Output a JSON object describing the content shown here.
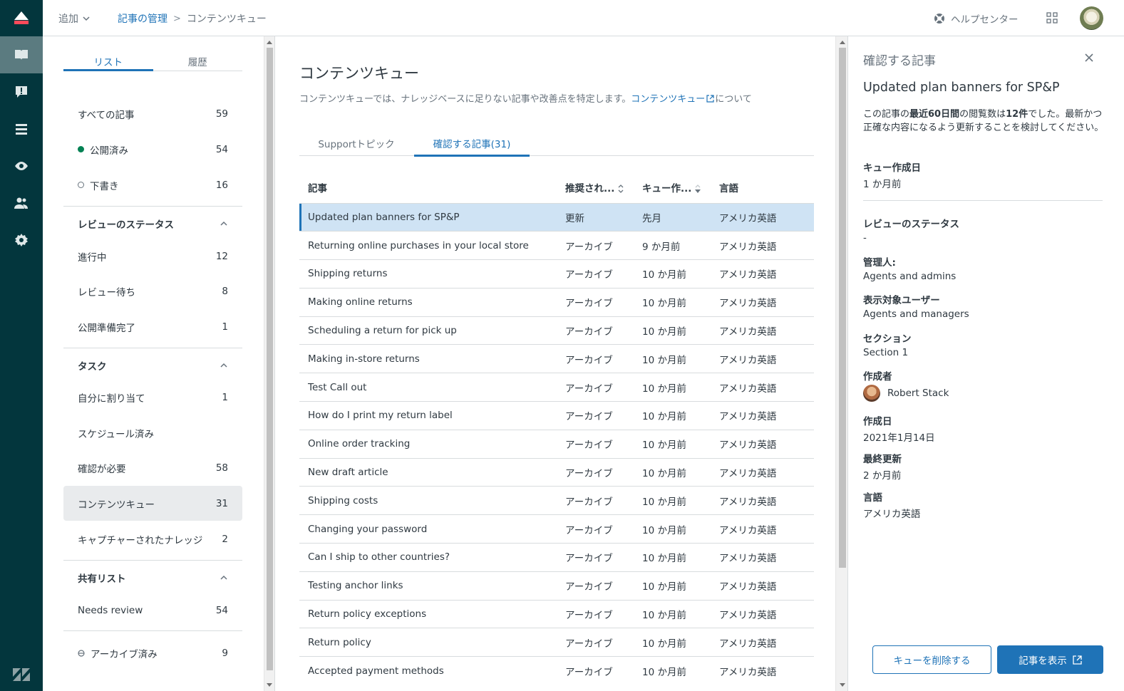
{
  "topbar": {
    "add_label": "追加",
    "breadcrumb": {
      "parent": "記事の管理",
      "separator": ">",
      "current": "コンテンツキュー"
    },
    "help_label": "ヘルプセンター"
  },
  "left": {
    "tabs": [
      "リスト",
      "履歴"
    ],
    "rows": [
      {
        "label": "すべての記事",
        "count": "59"
      },
      {
        "label": "公開済み",
        "count": "54"
      },
      {
        "label": "下書き",
        "count": "16"
      }
    ],
    "review_status": {
      "title": "レビューのステータス",
      "items": [
        {
          "label": "進行中",
          "count": "12"
        },
        {
          "label": "レビュー待ち",
          "count": "8"
        },
        {
          "label": "公開準備完了",
          "count": "1"
        }
      ]
    },
    "tasks": {
      "title": "タスク",
      "items": [
        {
          "label": "自分に割り当て",
          "count": "1"
        },
        {
          "label": "スケジュール済み",
          "count": ""
        },
        {
          "label": "確認が必要",
          "count": "58"
        },
        {
          "label": "コンテンツキュー",
          "count": "31"
        },
        {
          "label": "キャプチャーされたナレッジ",
          "count": "2"
        }
      ]
    },
    "shared": {
      "title": "共有リスト",
      "items": [
        {
          "label": "Needs review",
          "count": "54"
        }
      ]
    },
    "archived": {
      "label": "アーカイブ済み",
      "count": "9"
    }
  },
  "main": {
    "title": "コンテンツキュー",
    "desc_prefix": "コンテンツキューでは、ナレッジベースに足りない記事や改善点を特定します。",
    "desc_link": "コンテンツキュー",
    "desc_suffix": "について",
    "tabs": [
      "Supportトピック",
      "確認する記事(31)"
    ],
    "columns": [
      "記事",
      "推奨され...",
      "キュー作...",
      "言語"
    ],
    "rows": [
      [
        "Updated plan banners for SP&P",
        "更新",
        "先月",
        "アメリカ英語"
      ],
      [
        "Returning online purchases in your local store",
        "アーカイブ",
        "9 か月前",
        "アメリカ英語"
      ],
      [
        "Shipping returns",
        "アーカイブ",
        "10 か月前",
        "アメリカ英語"
      ],
      [
        "Making online returns",
        "アーカイブ",
        "10 か月前",
        "アメリカ英語"
      ],
      [
        "Scheduling a return for pick up",
        "アーカイブ",
        "10 か月前",
        "アメリカ英語"
      ],
      [
        "Making in-store returns",
        "アーカイブ",
        "10 か月前",
        "アメリカ英語"
      ],
      [
        "Test Call out",
        "アーカイブ",
        "10 か月前",
        "アメリカ英語"
      ],
      [
        "How do I print my return label",
        "アーカイブ",
        "10 か月前",
        "アメリカ英語"
      ],
      [
        "Online order tracking",
        "アーカイブ",
        "10 か月前",
        "アメリカ英語"
      ],
      [
        "New draft article",
        "アーカイブ",
        "10 か月前",
        "アメリカ英語"
      ],
      [
        "Shipping costs",
        "アーカイブ",
        "10 か月前",
        "アメリカ英語"
      ],
      [
        "Changing your password",
        "アーカイブ",
        "10 か月前",
        "アメリカ英語"
      ],
      [
        "Can I ship to other countries?",
        "アーカイブ",
        "10 か月前",
        "アメリカ英語"
      ],
      [
        "Testing anchor links",
        "アーカイブ",
        "10 か月前",
        "アメリカ英語"
      ],
      [
        "Return policy exceptions",
        "アーカイブ",
        "10 か月前",
        "アメリカ英語"
      ],
      [
        "Return policy",
        "アーカイブ",
        "10 か月前",
        "アメリカ英語"
      ],
      [
        "Accepted payment methods",
        "アーカイブ",
        "10 か月前",
        "アメリカ英語"
      ]
    ]
  },
  "right": {
    "title": "確認する記事",
    "article_title": "Updated plan banners for SP&P",
    "note_parts": [
      "この記事の",
      "最近60日間",
      "の閲覧数は",
      "12件",
      "でした。最新かつ正確な内容になるよう更新することを検討してください。"
    ],
    "fields": [
      {
        "k": "キュー作成日",
        "v": "1 か月前"
      },
      {
        "k": "レビューのステータス",
        "v": "-"
      },
      {
        "k": "管理人:",
        "v": "Agents and admins"
      },
      {
        "k": "表示対象ユーザー",
        "v": "Agents and managers"
      },
      {
        "k": "セクション",
        "v": "Section 1"
      },
      {
        "k": "作成者",
        "v": "Robert Stack"
      },
      {
        "k": "作成日",
        "v": "2021年1月14日"
      },
      {
        "k": "最終更新",
        "v": "2 か月前"
      },
      {
        "k": "言語",
        "v": "アメリカ英語"
      }
    ],
    "remove_button": "キューを削除する",
    "view_button": "記事を表示"
  },
  "colors": {
    "accent": "#1f73b7",
    "rail": "#03363d",
    "selected_row": "#cfe3f4",
    "published": "#038153"
  }
}
